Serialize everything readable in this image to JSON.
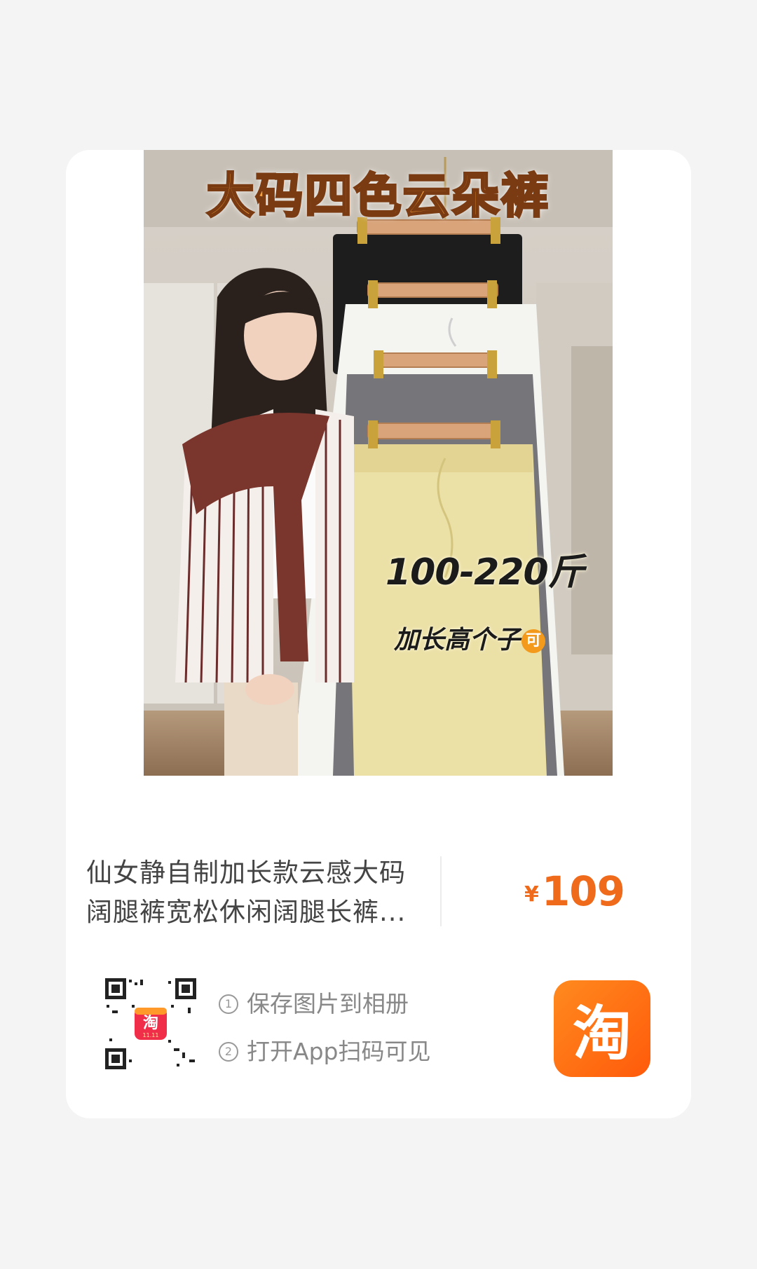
{
  "product": {
    "image_banner": "大码四色云朵裤",
    "image_range": "100-220斤",
    "image_tall": "加长高个子",
    "image_tall_badge": "可",
    "title_line1": "仙女静自制加长款云感大码",
    "title_line2": "阔腿裤宽松休闲阔腿长裤...",
    "price_symbol": "¥",
    "price": "109"
  },
  "share": {
    "qr_badge": "淘",
    "qr_badge_sub": "11.11",
    "step1_num": "1",
    "step1": "保存图片到相册",
    "step2_num": "2",
    "step2": "打开App扫码可见",
    "app_logo_text": "淘"
  },
  "colors": {
    "accent": "#ef6a1a",
    "logo": "#ff6a0e"
  }
}
